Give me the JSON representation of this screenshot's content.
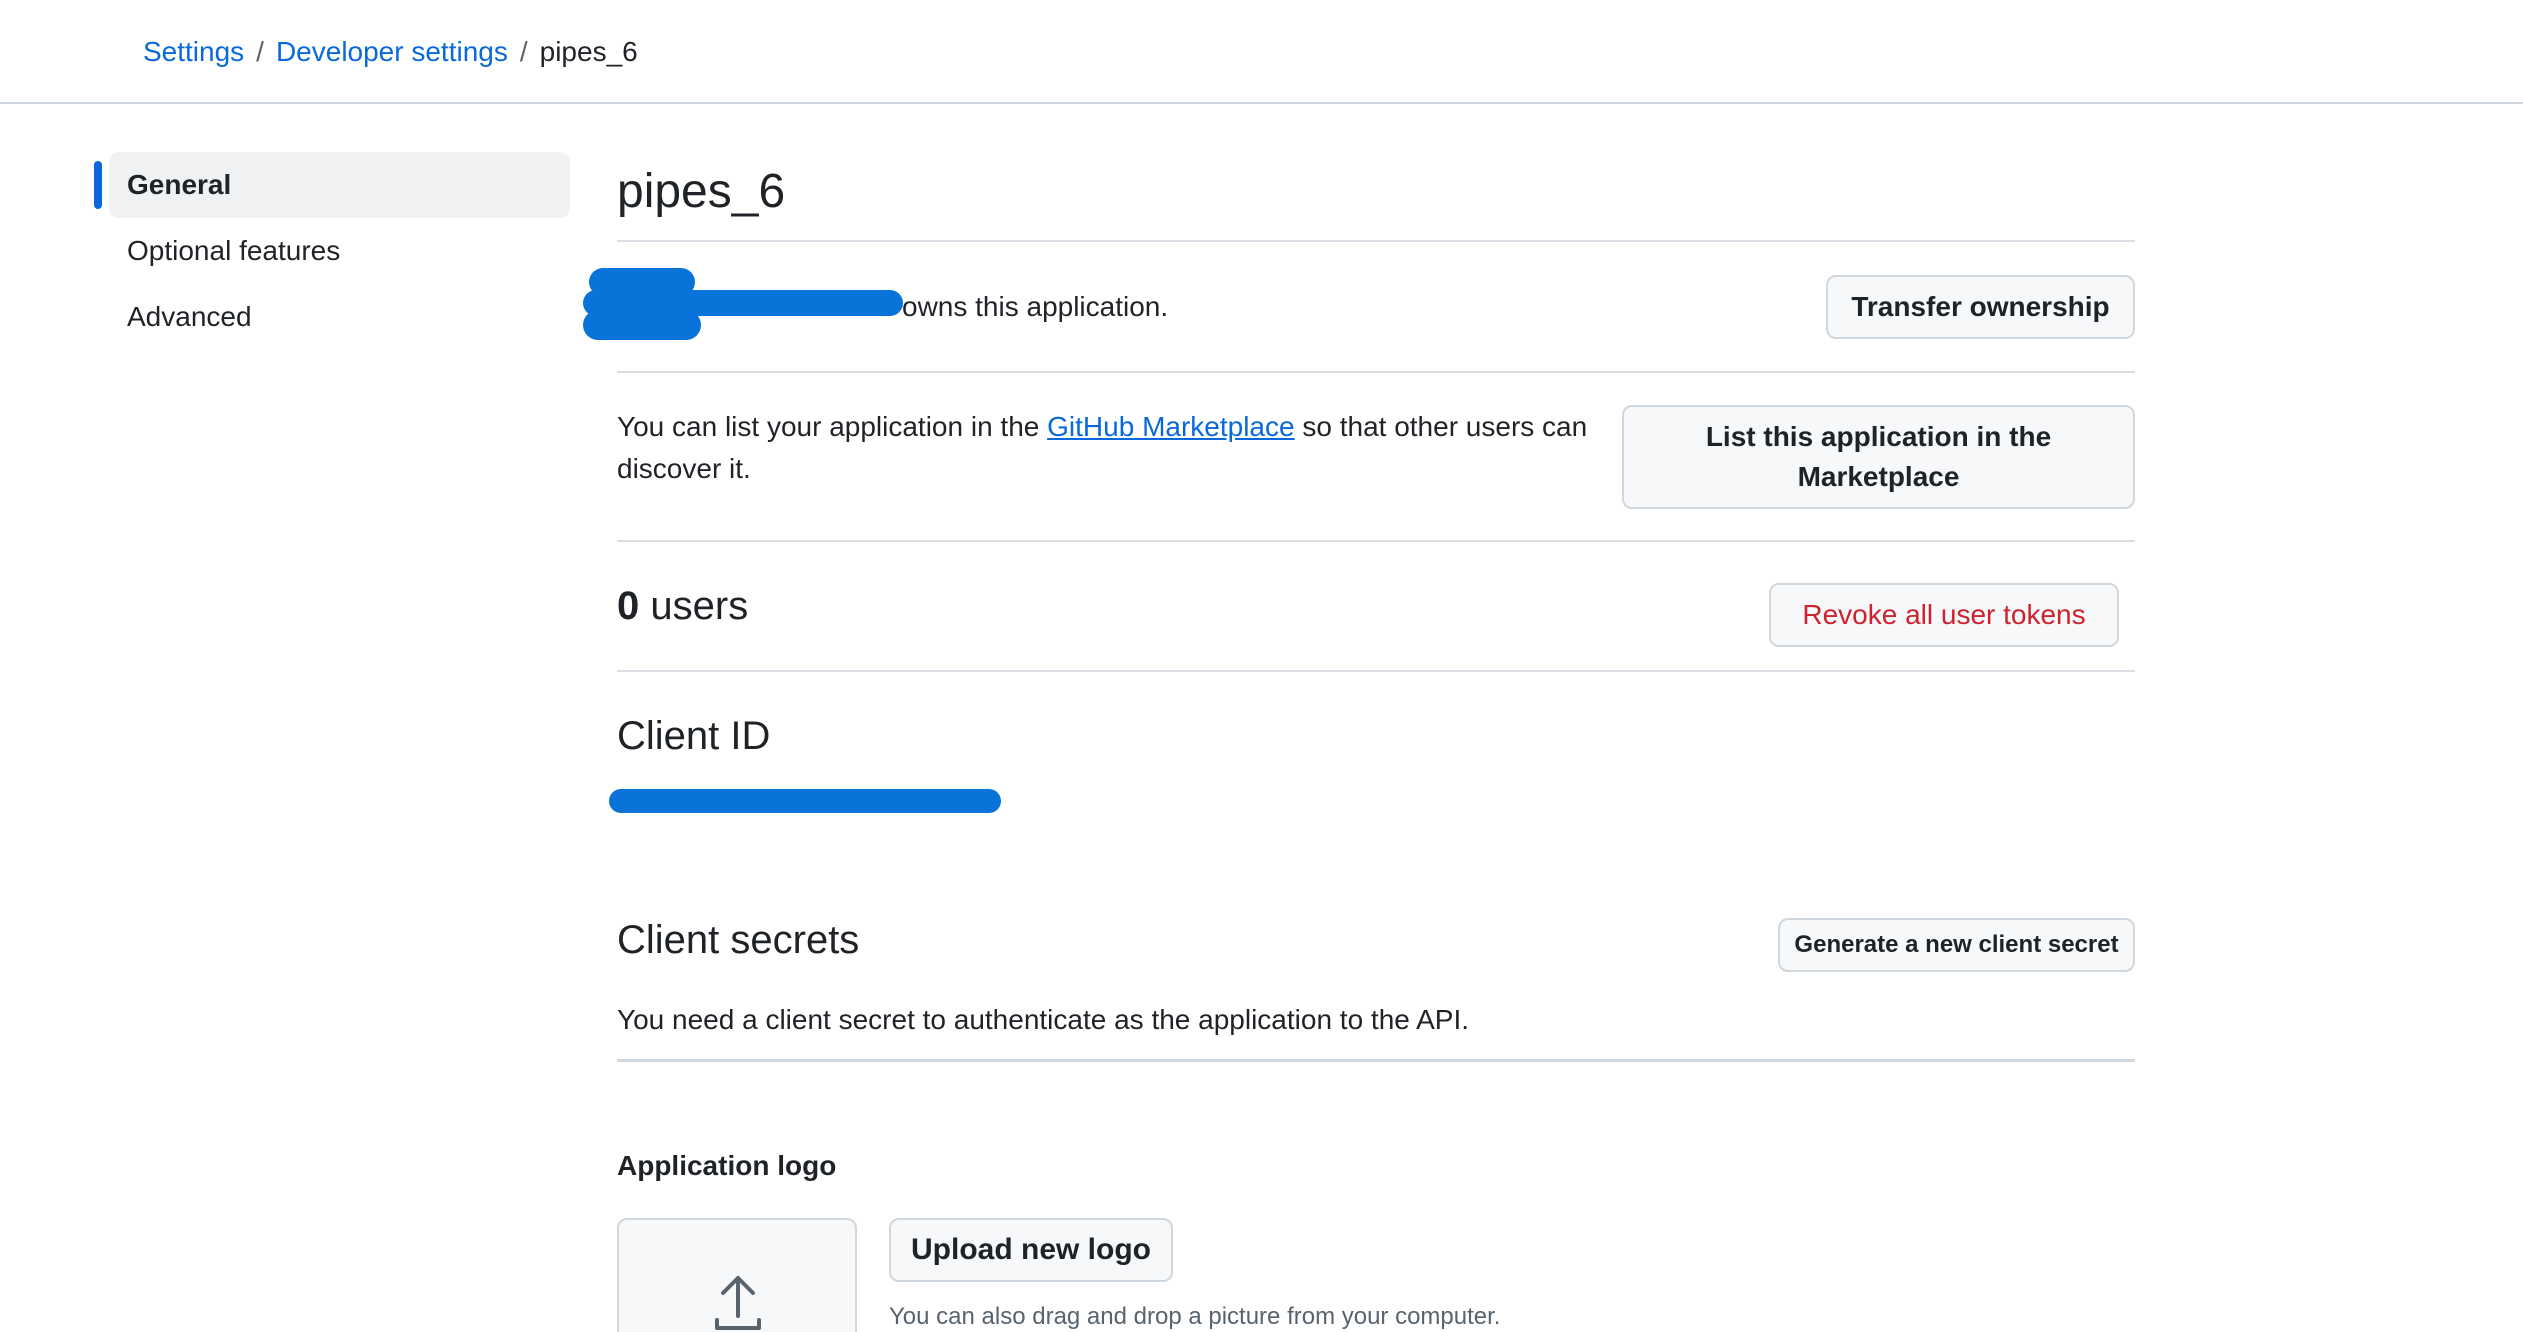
{
  "breadcrumb": {
    "settings": "Settings",
    "developer_settings": "Developer settings",
    "current": "pipes_6",
    "separator": "/"
  },
  "sidebar": {
    "items": [
      {
        "label": "General",
        "active": true
      },
      {
        "label": "Optional features",
        "active": false
      },
      {
        "label": "Advanced",
        "active": false
      }
    ]
  },
  "main": {
    "title": "pipes_6",
    "owner": {
      "text_suffix": "owns this application.",
      "transfer_button": "Transfer ownership"
    },
    "marketplace": {
      "text_before": "You can list your application in the",
      "link": "GitHub Marketplace",
      "text_after": "so that other users can discover it.",
      "button": "List this application in the Marketplace"
    },
    "users": {
      "count": "0",
      "label": "users",
      "revoke_button": "Revoke all user tokens"
    },
    "client_id": {
      "heading": "Client ID"
    },
    "client_secrets": {
      "heading": "Client secrets",
      "description": "You need a client secret to authenticate as the application to the API.",
      "generate_button": "Generate a new client secret"
    },
    "logo": {
      "heading": "Application logo",
      "upload_button": "Upload new logo",
      "hint": "You can also drag and drop a picture from your computer."
    }
  },
  "colors": {
    "accent": "#0969da",
    "danger": "#cf222e",
    "border": "#d0d7de",
    "redaction": "#0a73d9"
  }
}
